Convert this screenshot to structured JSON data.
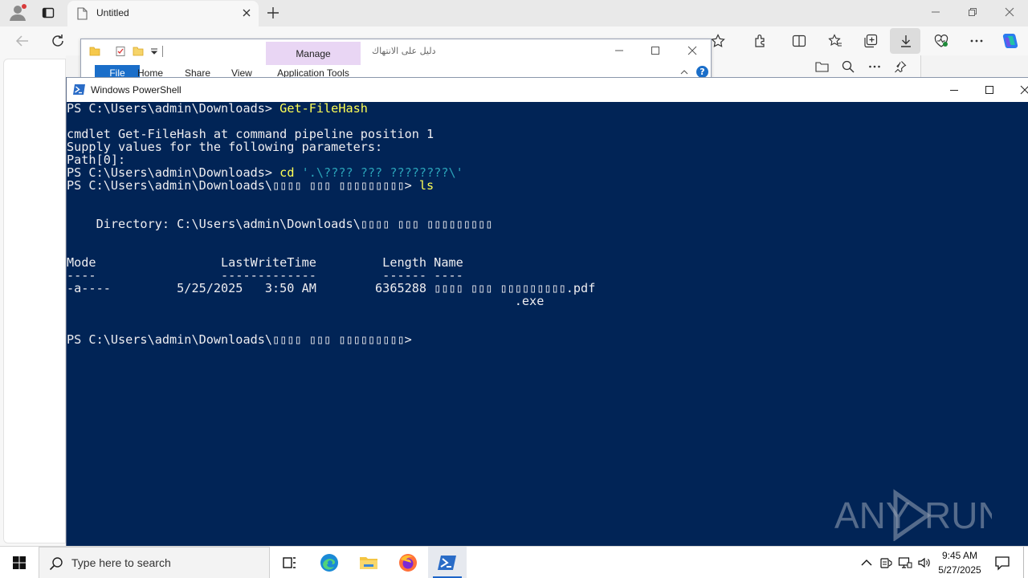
{
  "browser": {
    "tab_title": "Untitled"
  },
  "explorer": {
    "title": "دليل على الانتهاك",
    "manage_label": "Manage",
    "app_tools_label": "Application Tools",
    "tabs": [
      "File",
      "Home",
      "Share",
      "View"
    ],
    "help_label": "?"
  },
  "powershell": {
    "title": "Windows PowerShell",
    "background": "#012456",
    "lines": [
      [
        {
          "t": "PS C:\\Users\\admin\\Downloads> "
        },
        {
          "t": "Get-FileHash",
          "c": "yellow"
        }
      ],
      [
        {
          "t": ""
        }
      ],
      [
        {
          "t": "cmdlet Get-FileHash at command pipeline position 1"
        }
      ],
      [
        {
          "t": "Supply values for the following parameters:"
        }
      ],
      [
        {
          "t": "Path[0]:"
        }
      ],
      [
        {
          "t": "PS C:\\Users\\admin\\Downloads> "
        },
        {
          "t": "cd",
          "c": "yellow"
        },
        {
          "t": " "
        },
        {
          "t": "'.\\???? ??? ????????\\'",
          "c": "cyan"
        }
      ],
      [
        {
          "t": "PS C:\\Users\\admin\\Downloads\\▯▯▯▯ ▯▯▯ ▯▯▯▯▯▯▯▯▯> "
        },
        {
          "t": "ls",
          "c": "yellow"
        }
      ],
      [
        {
          "t": ""
        }
      ],
      [
        {
          "t": ""
        }
      ],
      [
        {
          "t": "    Directory: C:\\Users\\admin\\Downloads\\▯▯▯▯ ▯▯▯ ▯▯▯▯▯▯▯▯▯"
        }
      ],
      [
        {
          "t": ""
        }
      ],
      [
        {
          "t": ""
        }
      ],
      [
        {
          "t": "Mode                 LastWriteTime         Length Name"
        }
      ],
      [
        {
          "t": "----                 -------------         ------ ----"
        }
      ],
      [
        {
          "t": "-a----         5/25/2025   3:50 AM        6365288 ▯▯▯▯ ▯▯▯ ▯▯▯▯▯▯▯▯▯.pdf"
        }
      ],
      [
        {
          "t": "                                                             .exe"
        }
      ],
      [
        {
          "t": ""
        }
      ],
      [
        {
          "t": ""
        }
      ],
      [
        {
          "t": "PS C:\\Users\\admin\\Downloads\\▯▯▯▯ ▯▯▯ ▯▯▯▯▯▯▯▯▯>"
        }
      ]
    ]
  },
  "watermark": {
    "text_any": "ANY",
    "text_run": "RUN"
  },
  "taskbar": {
    "search_placeholder": "Type here to search",
    "time": "9:45 AM",
    "date": "5/27/2025",
    "apps": [
      "task-view",
      "edge",
      "file-explorer",
      "firefox",
      "powershell"
    ]
  }
}
